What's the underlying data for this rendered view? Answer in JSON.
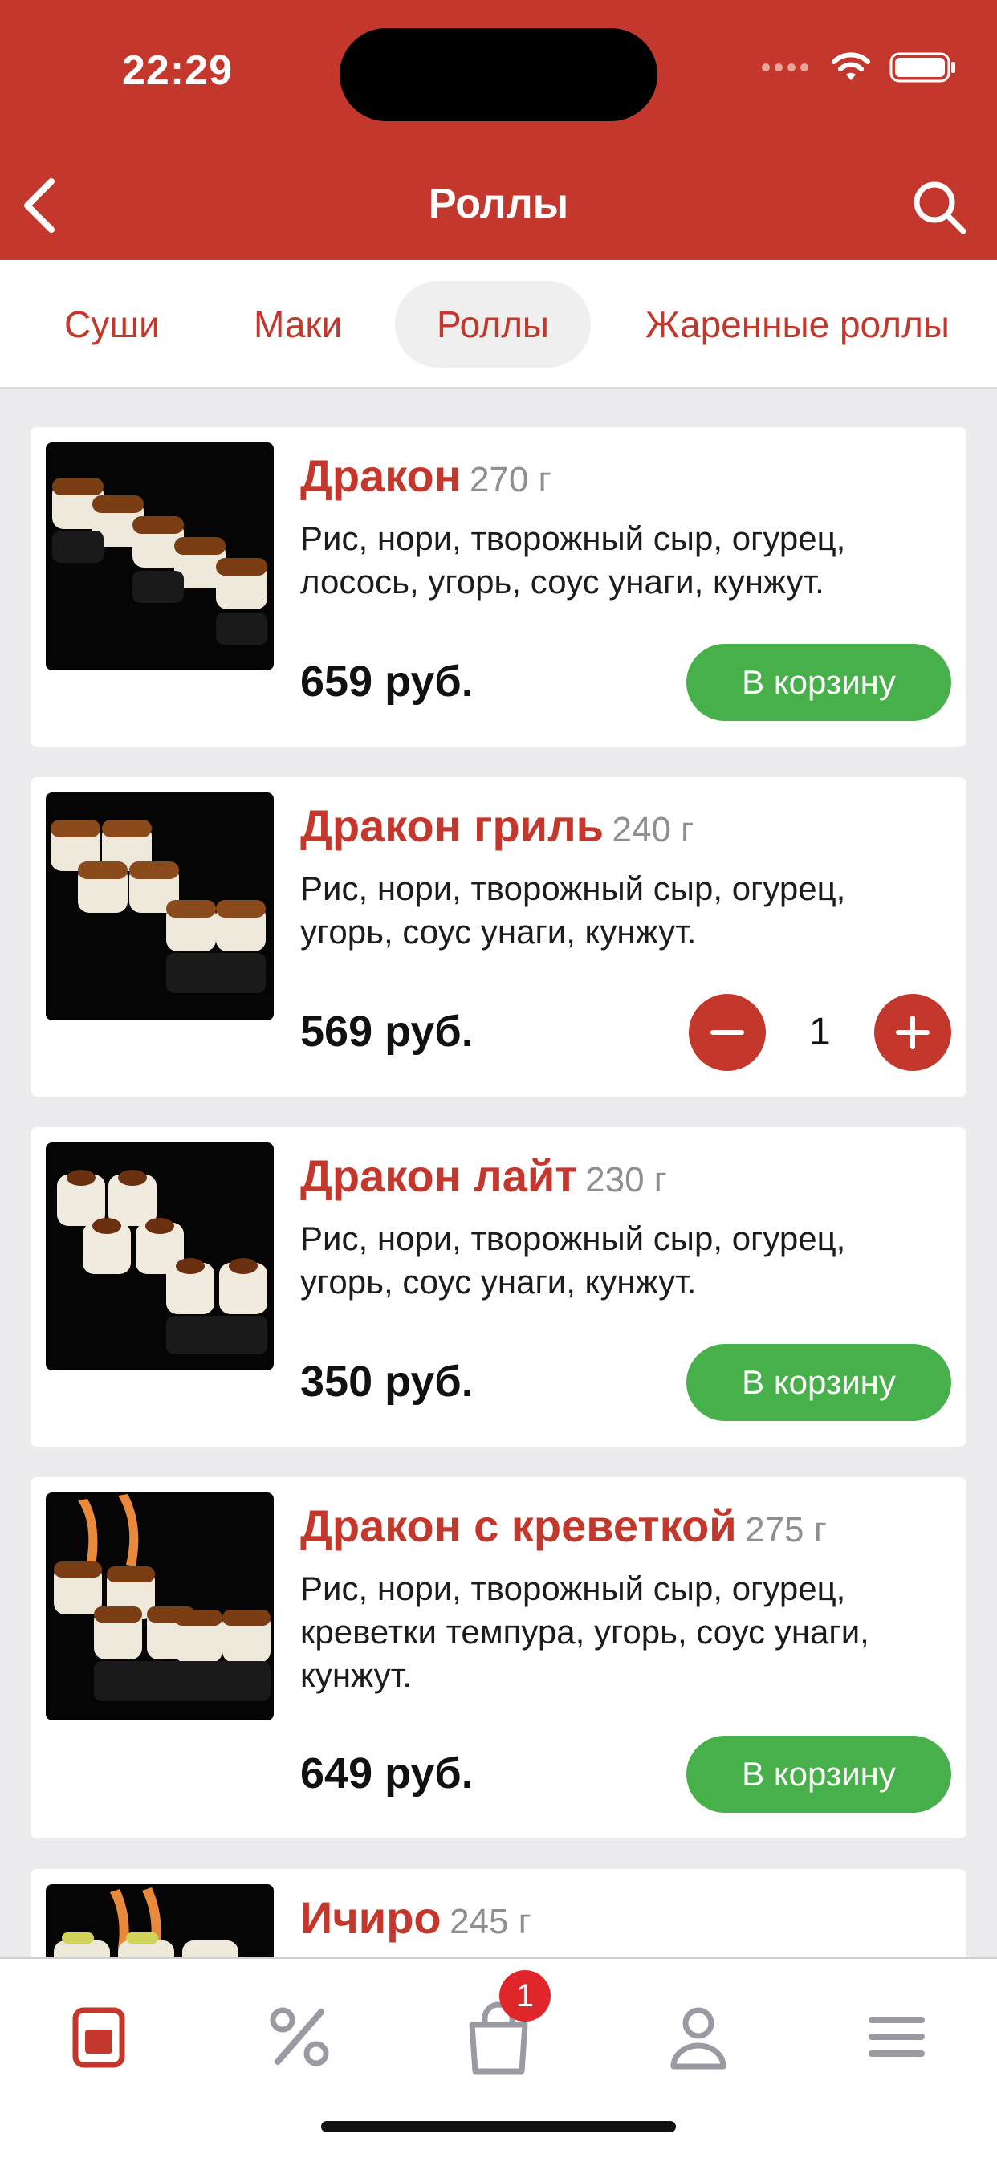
{
  "status_bar": {
    "time": "22:29"
  },
  "nav": {
    "title": "Роллы",
    "back_icon": "chevron-left-icon",
    "search_icon": "search-icon"
  },
  "tabs": [
    {
      "label": "Суши",
      "active": false
    },
    {
      "label": "Маки",
      "active": false
    },
    {
      "label": "Роллы",
      "active": true
    },
    {
      "label": "Жаренные роллы",
      "active": false
    }
  ],
  "products": [
    {
      "name": "Дракон",
      "weight": "270 г",
      "description": "Рис, нори, творожный сыр, огурец, лосось, угорь, соус унаги, кунжут.",
      "price": "659 руб.",
      "action": "В корзину"
    },
    {
      "name": "Дракон гриль",
      "weight": "240 г",
      "description": "Рис, нори, творожный сыр, огурец, угорь, соус унаги, кунжут.",
      "price": "569 руб.",
      "quantity": "1"
    },
    {
      "name": "Дракон лайт",
      "weight": "230 г",
      "description": "Рис, нори, творожный сыр, огурец, угорь, соус унаги, кунжут.",
      "price": "350 руб.",
      "action": "В корзину"
    },
    {
      "name": "Дракон с креветкой",
      "weight": "275 г",
      "description": "Рис, нори, творожный сыр, огурец, креветки темпура, угорь, соус унаги, кунжут.",
      "price": "649 руб.",
      "action": "В корзину"
    },
    {
      "name": "Ичиро",
      "weight": "245 г"
    }
  ],
  "tabbar": {
    "items": [
      "menu-icon",
      "percent-icon",
      "cart-icon",
      "profile-icon",
      "hamburger-icon"
    ],
    "cart_badge": "1"
  },
  "colors": {
    "brand": "#c3372c",
    "cart_button": "#48b04a",
    "badge": "#e0262b"
  }
}
